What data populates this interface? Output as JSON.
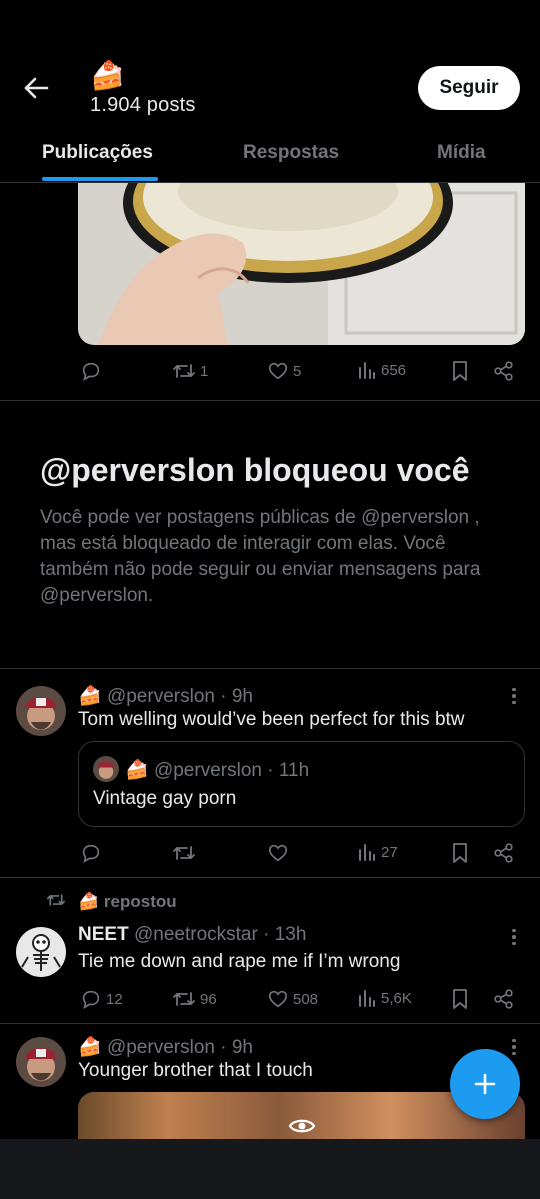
{
  "header": {
    "title_emoji": "🍰",
    "posts_count": "1.904 posts",
    "follow_label": "Seguir",
    "tabs": [
      "Publicações",
      "Respostas",
      "Mídia"
    ]
  },
  "photo_post": {
    "reposts": "1",
    "likes": "5",
    "views": "656"
  },
  "blocked": {
    "title": "@perverslon bloqueou você",
    "body": "Você pode ver postagens públicas de @perverslon , mas está bloqueado de interagir com elas. Você também não pode seguir ou enviar mensagens para @perverslon."
  },
  "tweet1": {
    "emoji": "🍰",
    "handle": "@perverslon",
    "time": "· 9h",
    "text": "Tom welling would’ve been perfect for this btw",
    "quote": {
      "emoji": "🍰",
      "handle": "@perverslon",
      "time": "· 11h",
      "text": "Vintage gay porn"
    },
    "views": "27"
  },
  "tweet2": {
    "repost_emoji": "🍰",
    "repost_label": "repostou",
    "name": "NEET",
    "handle": "@neetrockstar",
    "time": "· 13h",
    "text": "Tie me down and rape me if I’m wrong",
    "replies": "12",
    "reposts": "96",
    "likes": "508",
    "views": "5,6K"
  },
  "tweet3": {
    "emoji": "🍰",
    "handle": "@perverslon",
    "time": "· 9h",
    "text": "Younger brother that I touch"
  },
  "colors": {
    "accent": "#1d9bf0",
    "muted": "#71767b",
    "text": "#e7e9ea",
    "divider": "#2f3336"
  }
}
